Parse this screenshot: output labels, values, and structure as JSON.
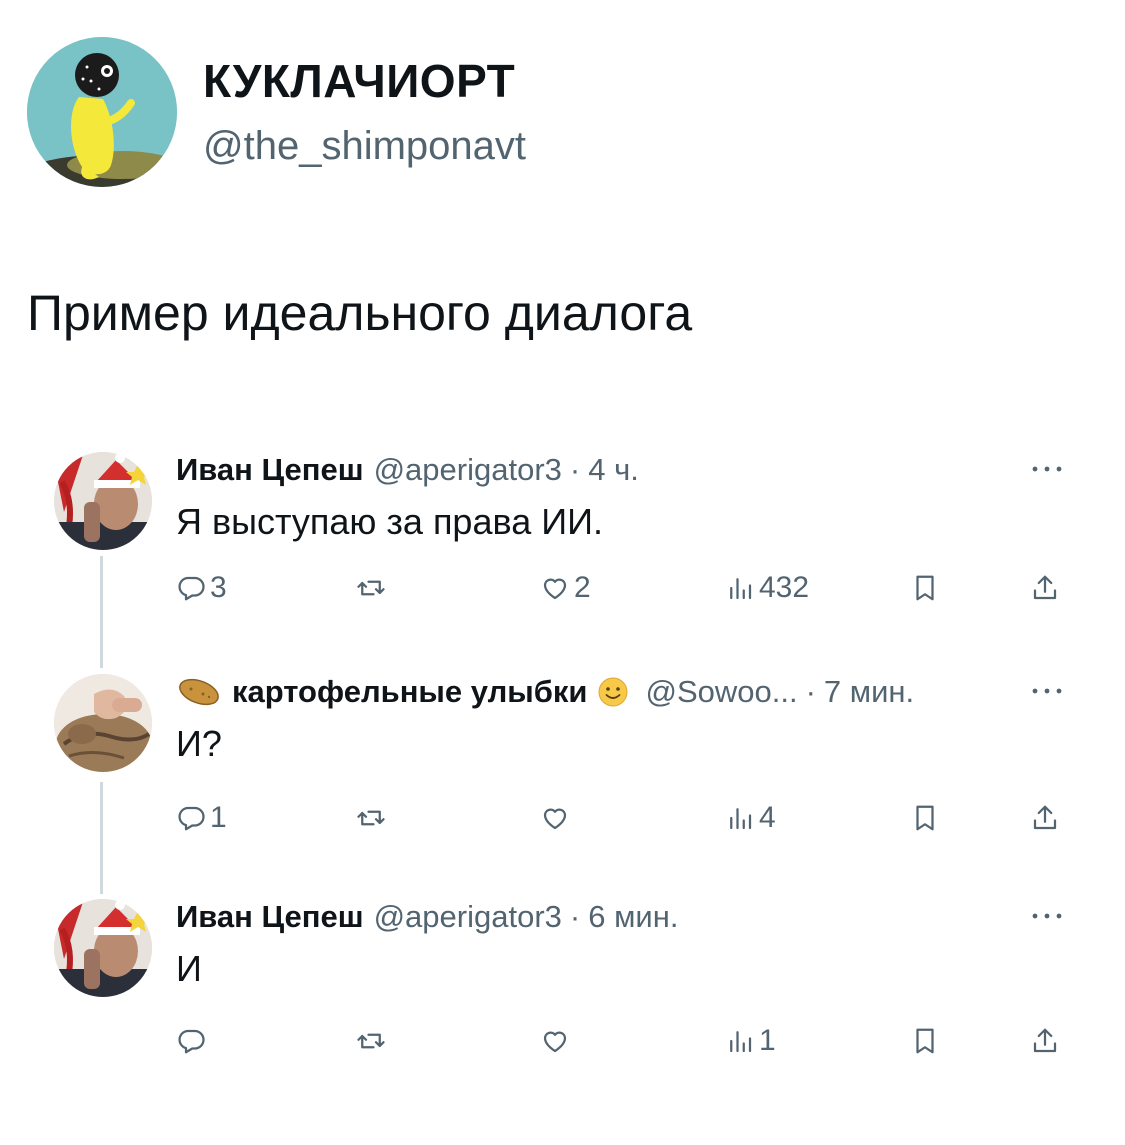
{
  "author": {
    "name": "КУКЛАЧИОРТ",
    "handle": "@the_shimponavt",
    "avatar": "yellow-figure-avatar"
  },
  "tweet": {
    "text": "Пример идеального диалога"
  },
  "replies": [
    {
      "name": "Иван Цепеш",
      "handle": "@aperigator3",
      "separator": "·",
      "time": "4 ч.",
      "text": "Я выступаю за права ИИ.",
      "avatar": "man-santa-hat-avatar",
      "counts": {
        "reply": "3",
        "retweet": "",
        "like": "2",
        "views": "432"
      }
    },
    {
      "name": "картофельные улыбки",
      "name_prefix_icon": "potato-icon",
      "name_suffix_icon": "smile-emoji-icon",
      "handle": "@Sowoo...",
      "separator": "·",
      "time": "7 мин.",
      "text": "И?",
      "avatar": "cat-being-petted-avatar",
      "counts": {
        "reply": "1",
        "retweet": "",
        "like": "",
        "views": "4"
      }
    },
    {
      "name": "Иван Цепеш",
      "handle": "@aperigator3",
      "separator": "·",
      "time": "6 мин.",
      "text": "И",
      "avatar": "man-santa-hat-avatar",
      "counts": {
        "reply": "",
        "retweet": "",
        "like": "",
        "views": "1"
      }
    }
  ],
  "colors": {
    "text": "#0f1419",
    "secondary": "#536471",
    "thread_line": "#cfd9de"
  }
}
